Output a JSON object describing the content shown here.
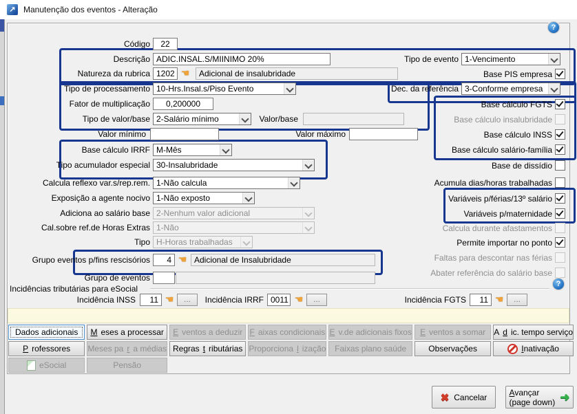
{
  "window": {
    "title": "Manutenção dos eventos - Alteração",
    "app_icon_glyph": "↗",
    "help_glyph": "?"
  },
  "icons": {
    "lookup": "☚",
    "cancel_x": "✖",
    "advance_arrow": "➜"
  },
  "colors": {
    "highlight_border": "#17368f",
    "panel_bg": "#f0f0f0",
    "hint_strip": "#fbfae0"
  },
  "form": {
    "codigo": {
      "label": "Código",
      "value": "22"
    },
    "descricao": {
      "label": "Descrição",
      "value": "ADIC.INSAL.S/MIINIMO 20%"
    },
    "natureza": {
      "label": "Natureza da rubrica",
      "code": "1202",
      "desc": "Adicional de insalubridade"
    },
    "tipo_processamento": {
      "label": "Tipo de processamento",
      "value": "10-Hrs.Insal.s/Piso Evento"
    },
    "fator_multiplicacao": {
      "label": "Fator de multiplicação",
      "value": "0,200000"
    },
    "tipo_valor_base": {
      "label": "Tipo de valor/base",
      "value": "2-Salário mínimo"
    },
    "valor_base": {
      "label": "Valor/base",
      "value": ""
    },
    "valor_minimo": {
      "label": "Valor mínimo",
      "value": ""
    },
    "valor_maximo": {
      "label": "Valor máximo",
      "value": ""
    },
    "base_calculo_irrf": {
      "label": "Base cálculo IRRF",
      "value": "M-Mês"
    },
    "tipo_acumulador": {
      "label": "Tipo acumulador especial",
      "value": "30-Insalubridade"
    },
    "calcula_reflexo": {
      "label": "Calcula reflexo var.s/rep.rem.",
      "value": "1-Não calcula"
    },
    "exposicao_agente": {
      "label": "Exposição a agente nocivo",
      "value": "1-Não exposto"
    },
    "adiciona_salario": {
      "label": "Adiciona ao salário base",
      "value": "2-Nenhum valor adicional"
    },
    "cal_horas_extras": {
      "label": "Cal.sobre ref.de Horas Extras",
      "value": "1-Não"
    },
    "tipo": {
      "label": "Tipo",
      "value": "H-Horas trabalhadas"
    },
    "grupo_rescisorios": {
      "label": "Grupo eventos p/fins rescisórios",
      "code": "4",
      "desc": "Adicional de Insalubridade"
    },
    "grupo_eventos": {
      "label": "Grupo de eventos",
      "code": "",
      "desc": ""
    },
    "tipo_evento": {
      "label": "Tipo de evento",
      "value": "1-Vencimento"
    },
    "dec_referencia": {
      "label": "Dec. da referência",
      "value": "3-Conforme empresa"
    }
  },
  "checks": {
    "base_pis": {
      "label": "Base PIS empresa",
      "checked": true
    },
    "base_fgts": {
      "label": "Base cálculo FGTS",
      "checked": true
    },
    "base_insalubridade": {
      "label": "Base cálculo insalubridade",
      "checked": false
    },
    "base_inss": {
      "label": "Base cálculo INSS",
      "checked": true
    },
    "base_salario_familia": {
      "label": "Base cálculo salário-família",
      "checked": true
    },
    "base_dissidio": {
      "label": "Base de dissídio",
      "checked": false
    },
    "acumula_dias": {
      "label": "Acumula dias/horas trabalhadas",
      "checked": false
    },
    "variaveis_ferias": {
      "label": "Variáveis p/férias/13º salário",
      "checked": true
    },
    "variaveis_maternidade": {
      "label": "Variáveis p/maternidade",
      "checked": true
    },
    "calcula_afastamentos": {
      "label": "Calcula durante afastamentos",
      "checked": false
    },
    "importar_ponto": {
      "label": "Permite importar no ponto",
      "checked": true
    },
    "faltas_ferias": {
      "label": "Faltas para descontar nas férias",
      "checked": false
    },
    "abater_referencia": {
      "label": "Abater referência do salário base",
      "checked": false
    }
  },
  "esocial": {
    "legend": "Incidências tributárias para eSocial",
    "inss_label": "Incidência INSS",
    "inss_value": "11",
    "irrf_label": "Incidência IRRF",
    "irrf_value": "0011",
    "fgts_label": "Incidência FGTS",
    "fgts_value": "11",
    "more": "..."
  },
  "tabs": {
    "row1": [
      {
        "label": "Dados adicionais",
        "u": -1
      },
      {
        "label": "Meses a processar",
        "u": 0
      },
      {
        "label": "Eventos a deduzir",
        "u": 0
      },
      {
        "label": "Faixas condicionais",
        "u": 0
      },
      {
        "label": "Ev.de adicionais fixos",
        "u": 0
      },
      {
        "label": "Eventos a somar",
        "u": 0
      },
      {
        "label": "Adic. tempo serviço",
        "u": 1
      }
    ],
    "row2": [
      {
        "label": "Professores",
        "u": 0
      },
      {
        "label": "Meses para médias",
        "u": 8
      },
      {
        "label": "Regras tributárias",
        "u": 7
      },
      {
        "label": "Proporcionalização",
        "u": 11
      },
      {
        "label": "Faixas plano saúde",
        "u": -1
      },
      {
        "label": "Observações",
        "u": -1
      },
      {
        "label": "Inativação",
        "u": 0
      }
    ],
    "row3": [
      {
        "label": "eSocial",
        "u": -1
      },
      {
        "label": "Pensão",
        "u": -1
      }
    ]
  },
  "actions": {
    "cancel_label": "Cancelar",
    "advance": {
      "label": "Avançar",
      "u": 0
    },
    "advance_sub": "(page down)"
  }
}
